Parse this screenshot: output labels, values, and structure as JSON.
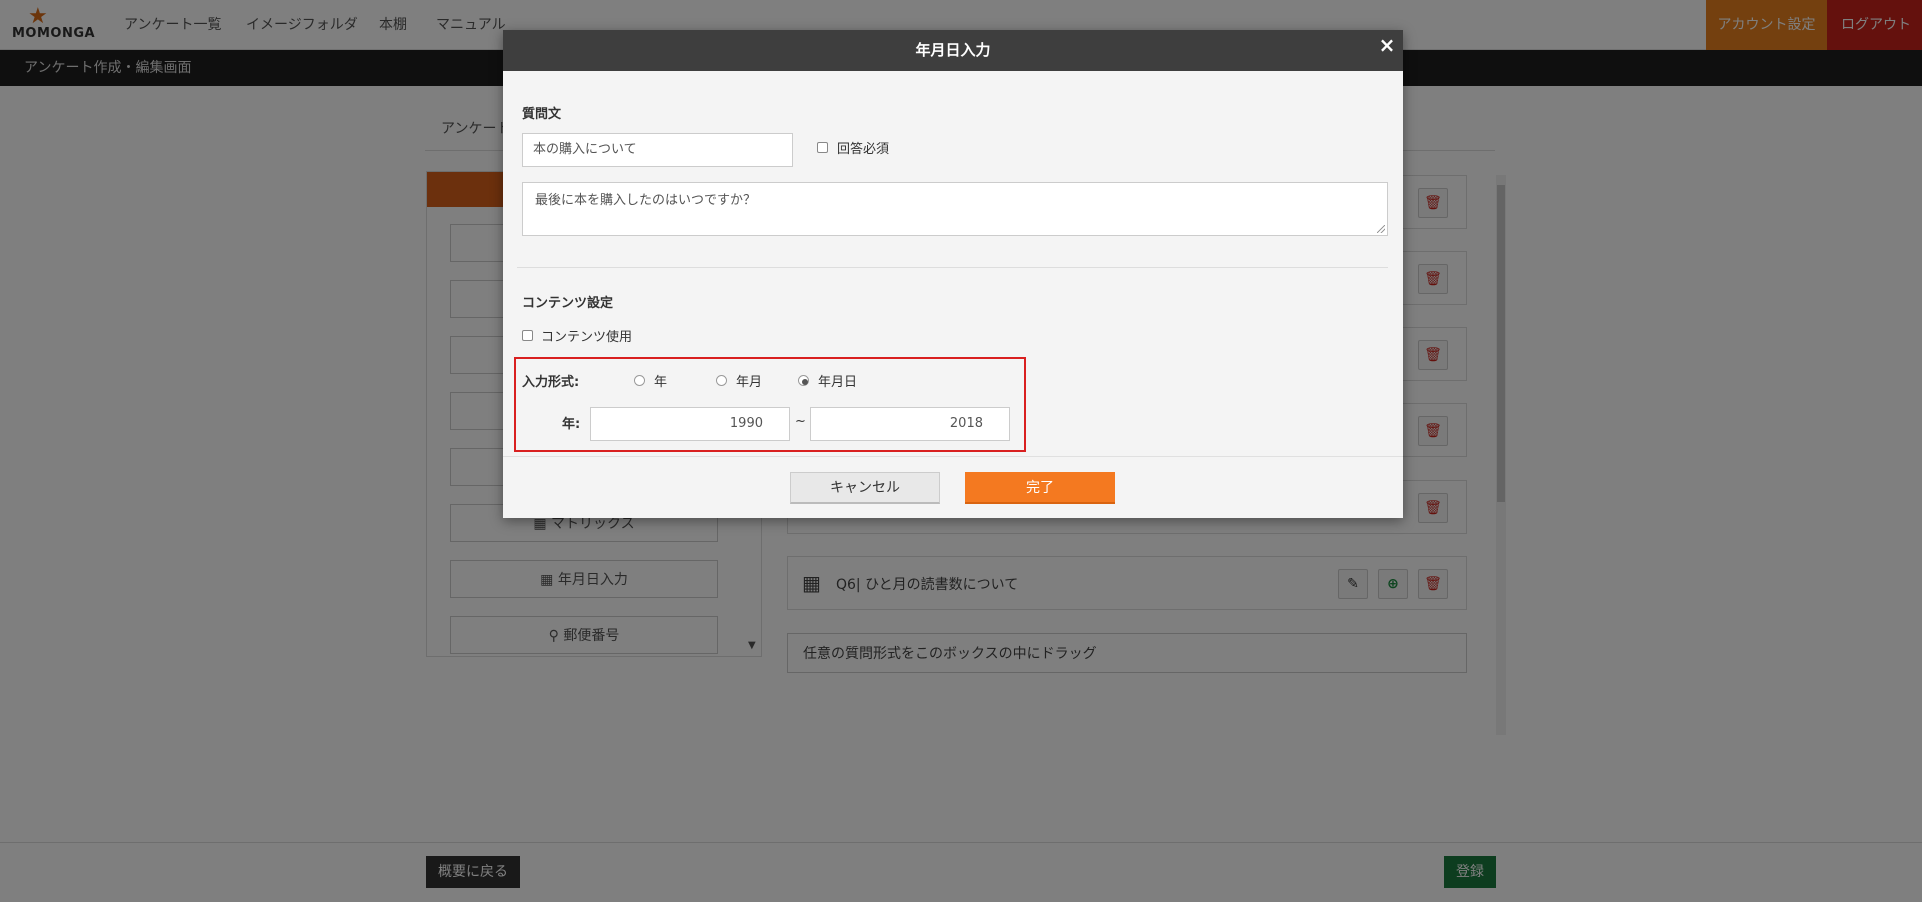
{
  "brand": {
    "logo_text": "MOMONGA"
  },
  "nav": {
    "items": [
      "アンケート一覧",
      "イメージフォルダ",
      "本棚",
      "マニュアル"
    ],
    "account_label": "アカウント設定",
    "logout_label": "ログアウト"
  },
  "subheader": {
    "title": "アンケート作成・編集画面"
  },
  "background": {
    "breadcrumb": "アンケート",
    "left_panel_items": [
      "",
      "",
      "",
      "",
      "",
      "マトリックス",
      "年月日入力",
      "郵便番号"
    ],
    "question_q6": "Q6| ひと月の読書数について",
    "drop_hint": "任意の質問形式をこのボックスの中にドラッグ"
  },
  "footer": {
    "back_label": "概要に戻る",
    "register_label": "登録"
  },
  "modal": {
    "title": "年月日入力",
    "close_symbol": "×",
    "question_section_label": "質問文",
    "question_title_value": "本の購入について",
    "required_label": "回答必須",
    "question_text_value": "最後に本を購入したのはいつですか？",
    "contents_section_label": "コンテンツ設定",
    "contents_use_label": "コンテンツ使用",
    "input_format_label": "入力形式:",
    "format_options": [
      "年",
      "年月",
      "年月日"
    ],
    "format_selected": "年月日",
    "year_label": "年:",
    "year_from": "1990",
    "range_sep": "~",
    "year_to": "2018",
    "cancel_label": "キャンセル",
    "done_label": "完了"
  },
  "colors": {
    "accent_orange": "#f47920",
    "account_btn": "#e8811f",
    "logout_btn": "#c8221b",
    "register_green": "#1a7a3e",
    "highlight_red": "#d92020"
  }
}
